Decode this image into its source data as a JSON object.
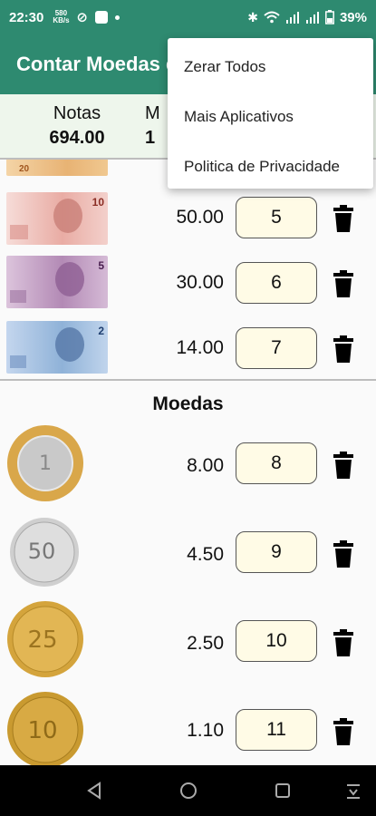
{
  "status": {
    "time": "22:30",
    "icons": [
      "580 KB/s",
      "no-sync-icon",
      "app-icon",
      "dot"
    ],
    "battery": "39%"
  },
  "app": {
    "title": "Contar Moedas e"
  },
  "summary": {
    "notas_label": "Notas",
    "notas_value": "694.00",
    "moedas_label": "M",
    "moedas_value": "1"
  },
  "bills": [
    {
      "denomination": "20",
      "amount": "",
      "qty": "",
      "color": "#e8b374"
    },
    {
      "denomination": "10",
      "amount": "50.00",
      "qty": "5",
      "color": "#e4a5a0"
    },
    {
      "denomination": "5",
      "amount": "30.00",
      "qty": "6",
      "color": "#b38ab5"
    },
    {
      "denomination": "2",
      "amount": "14.00",
      "qty": "7",
      "color": "#8fb2d8"
    }
  ],
  "coins_section": {
    "title": "Moedas"
  },
  "coins": [
    {
      "label": "1 REAL",
      "amount": "8.00",
      "qty": "8"
    },
    {
      "label": "50 CENTAVOS",
      "amount": "4.50",
      "qty": "9"
    },
    {
      "label": "25 CENTAVOS",
      "amount": "2.50",
      "qty": "10"
    },
    {
      "label": "10 CENTAVOS",
      "amount": "1.10",
      "qty": "11"
    }
  ],
  "menu": {
    "items": [
      "Zerar Todos",
      "Mais Aplicativos",
      "Politica de Privacidade"
    ]
  },
  "colors": {
    "primary": "#2e8a70",
    "summary_bg": "#eef6ec",
    "qty_bg": "#fffbe6"
  }
}
